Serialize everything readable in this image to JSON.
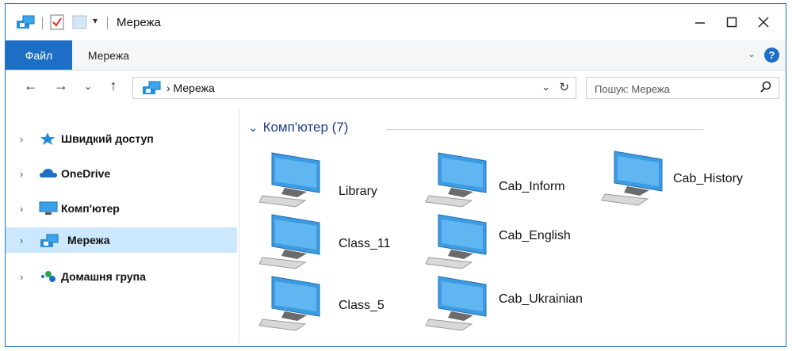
{
  "window": {
    "title": "Мережа"
  },
  "ribbon": {
    "file_tab": "Файл",
    "network_tab": "Мережа",
    "help": "?"
  },
  "address": {
    "path": "› Мережа"
  },
  "search": {
    "placeholder": "Пошук: Мережа"
  },
  "sidebar": {
    "items": [
      {
        "label": "Швидкий доступ",
        "icon": "star-icon"
      },
      {
        "label": "OneDrive",
        "icon": "cloud-icon"
      },
      {
        "label": "Комп'ютер",
        "icon": "monitor-icon"
      },
      {
        "label": "Мережа",
        "icon": "network-icon",
        "selected": true
      },
      {
        "label": "Домашня група",
        "icon": "homegroup-icon"
      }
    ]
  },
  "content": {
    "group": {
      "title": "Комп'ютер (7)"
    },
    "computers": [
      {
        "name": "Library"
      },
      {
        "name": "Cab_Inform"
      },
      {
        "name": "Cab_History"
      },
      {
        "name": "Class_11"
      },
      {
        "name": "Cab_English"
      },
      {
        "name": "Class_5"
      },
      {
        "name": "Cab_Ukrainian"
      }
    ]
  },
  "colors": {
    "accent": "#1c6fc4",
    "selected": "#cce8ff",
    "group_title": "#1c3c8c"
  }
}
